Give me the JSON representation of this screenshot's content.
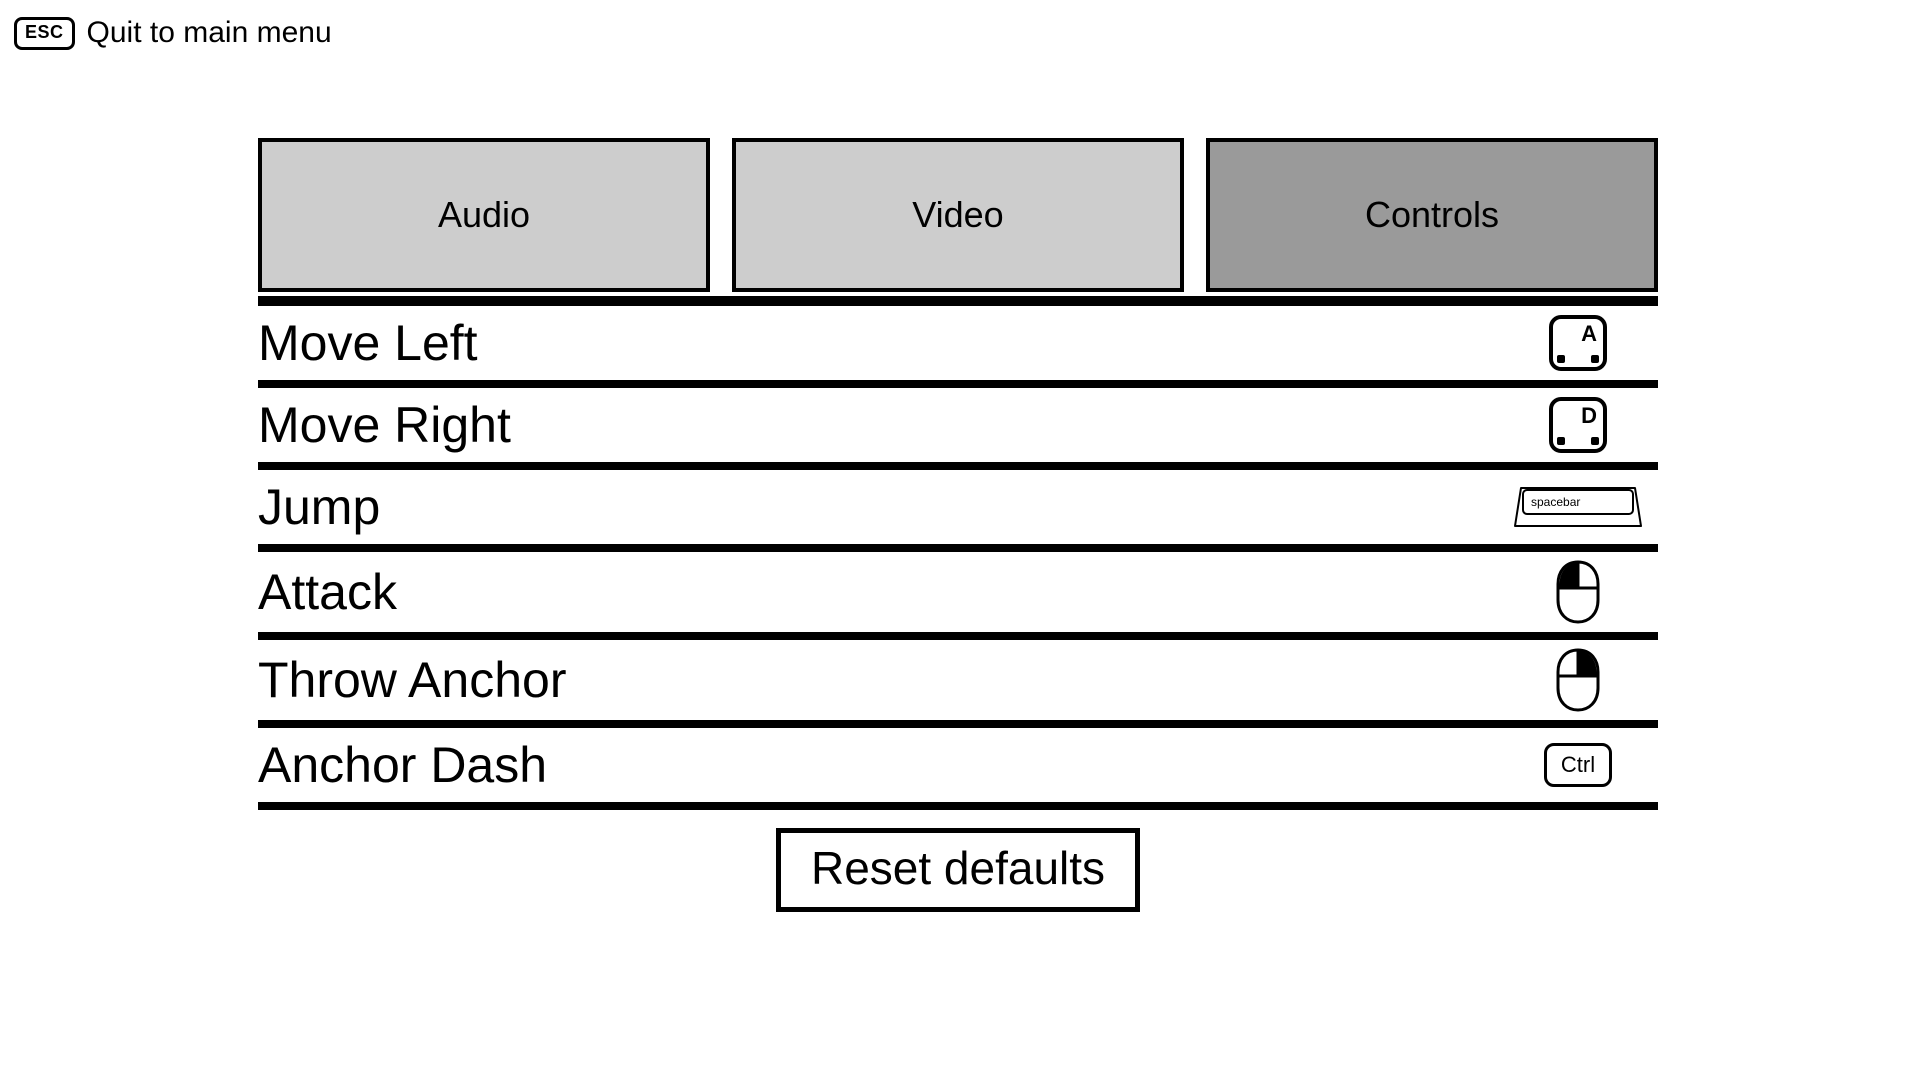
{
  "topbar": {
    "esc_label": "ESC",
    "quit_label": "Quit to main menu"
  },
  "tabs": [
    {
      "id": "audio",
      "label": "Audio",
      "active": false
    },
    {
      "id": "video",
      "label": "Video",
      "active": false
    },
    {
      "id": "controls",
      "label": "Controls",
      "active": true
    }
  ],
  "bindings": [
    {
      "action": "Move Left",
      "input_type": "key",
      "key_label": "A"
    },
    {
      "action": "Move Right",
      "input_type": "key",
      "key_label": "D"
    },
    {
      "action": "Jump",
      "input_type": "spacebar",
      "key_label": "spacebar"
    },
    {
      "action": "Attack",
      "input_type": "mouse",
      "button": "left"
    },
    {
      "action": "Throw Anchor",
      "input_type": "mouse",
      "button": "right"
    },
    {
      "action": "Anchor Dash",
      "input_type": "ctrl",
      "key_label": "Ctrl"
    }
  ],
  "reset_label": "Reset defaults"
}
